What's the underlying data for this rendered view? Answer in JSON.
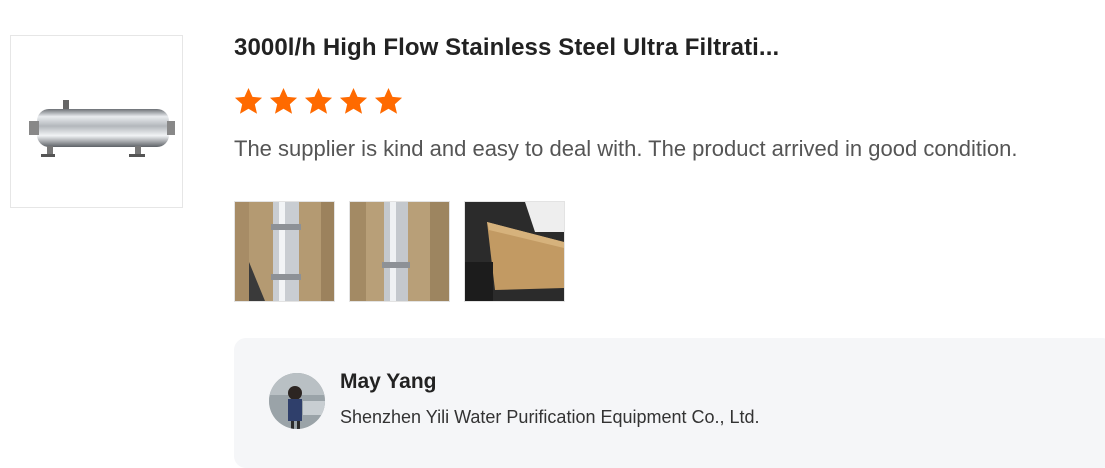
{
  "product": {
    "title": "3000l/h High Flow Stainless Steel Ultra Filtrati...",
    "rating": 5,
    "rating_max": 5,
    "thumbnail_icon": "stainless-steel-filter-housing"
  },
  "review": {
    "text": "The supplier is kind and easy to deal with. The product arrived in good condition.",
    "photos": [
      "review-photo-filter-in-box-1",
      "review-photo-filter-in-box-2",
      "review-photo-wooden-crate"
    ]
  },
  "supplier": {
    "name": "May Yang",
    "company": "Shenzhen Yili Water Purification Equipment Co., Ltd."
  },
  "colors": {
    "star": "#ff6a00",
    "card_background": "#f5f6f8"
  }
}
